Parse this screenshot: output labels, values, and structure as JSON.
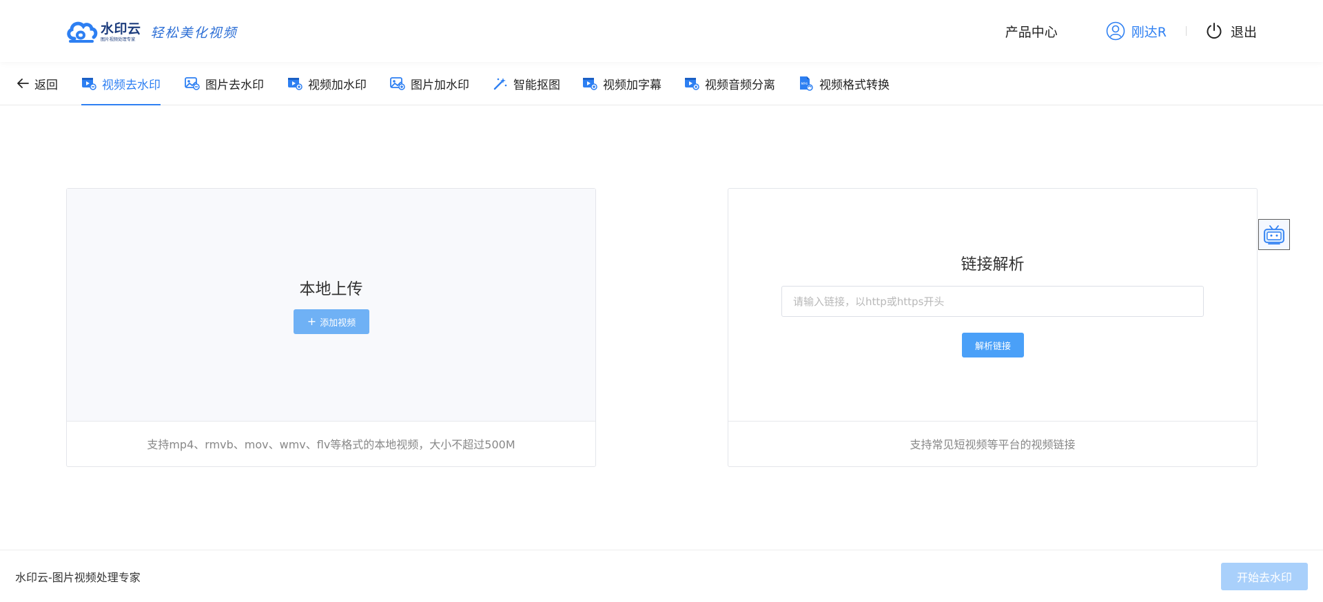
{
  "header": {
    "logo_name": "水印云",
    "logo_sub": "图片视频处理专家",
    "slogan": "轻松美化视频",
    "product_center": "产品中心",
    "username": "刚达R",
    "logout": "退出",
    "accent_color": "#2d7ff2"
  },
  "nav": {
    "back": "返回",
    "tabs": [
      {
        "label": "视频去水印",
        "icon": "video-remove-icon",
        "active": true
      },
      {
        "label": "图片去水印",
        "icon": "image-remove-icon",
        "active": false
      },
      {
        "label": "视频加水印",
        "icon": "video-add-icon",
        "active": false
      },
      {
        "label": "图片加水印",
        "icon": "image-add-icon",
        "active": false
      },
      {
        "label": "智能抠图",
        "icon": "magic-wand-icon",
        "active": false
      },
      {
        "label": "视频加字幕",
        "icon": "video-subtitle-icon",
        "active": false
      },
      {
        "label": "视频音频分离",
        "icon": "video-audio-icon",
        "active": false
      },
      {
        "label": "视频格式转换",
        "icon": "file-convert-icon",
        "active": false
      }
    ]
  },
  "upload": {
    "title": "本地上传",
    "button": "添加视频",
    "hint": "支持mp4、rmvb、mov、wmv、flv等格式的本地视频，大小不超过500M"
  },
  "link": {
    "title": "链接解析",
    "placeholder": "请输入链接，以http或https开头",
    "value": "",
    "button": "解析链接",
    "hint": "支持常见短视频等平台的视频链接"
  },
  "footer": {
    "text": "水印云-图片视频处理专家",
    "start_button": "开始去水印"
  }
}
